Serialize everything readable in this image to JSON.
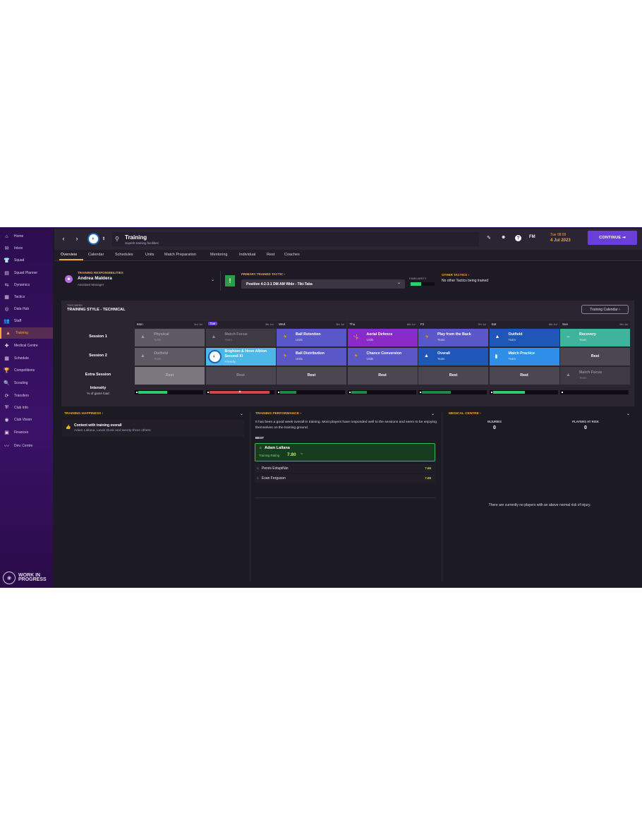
{
  "sidebar": {
    "items": [
      {
        "label": "Home",
        "icon": "⌂"
      },
      {
        "label": "Inbox",
        "icon": "✉"
      },
      {
        "label": "Squad",
        "icon": "👕"
      },
      {
        "label": "Squad Planner",
        "icon": "▤"
      },
      {
        "label": "Dynamics",
        "icon": "⇆"
      },
      {
        "label": "Tactics",
        "icon": "▦"
      },
      {
        "label": "Data Hub",
        "icon": "◎"
      },
      {
        "label": "Staff",
        "icon": "👥"
      },
      {
        "label": "Training",
        "icon": "▲"
      },
      {
        "label": "Medical Centre",
        "icon": "✚"
      },
      {
        "label": "Schedule",
        "icon": "▦"
      },
      {
        "label": "Competitions",
        "icon": "🏆"
      },
      {
        "label": "Scouting",
        "icon": "🔍"
      },
      {
        "label": "Transfers",
        "icon": "⟳"
      },
      {
        "label": "Club Info",
        "icon": "⛨"
      },
      {
        "label": "Club Vision",
        "icon": "◉"
      },
      {
        "label": "Finances",
        "icon": "▣"
      },
      {
        "label": "Dev. Centre",
        "icon": "〰"
      }
    ],
    "active_index": 8,
    "wip_label_1": "WORK IN",
    "wip_label_2": "PROGRESS"
  },
  "header": {
    "title": "Training",
    "subtitle": "Superb training facilities",
    "fm_label": "FM",
    "time": "Tue 08:00",
    "date": "4 Jul 2023",
    "continue_label": "CONTINUE"
  },
  "tabs": [
    "Overview",
    "Calendar",
    "Schedules",
    "Units",
    "Match Preparation",
    "Mentoring",
    "Individual",
    "Rest",
    "Coaches"
  ],
  "responsibilities": {
    "label": "TRAINING RESPONSIBILITIES",
    "name": "Andrea Maldera",
    "role": "Assistant Manager"
  },
  "primary_tactic": {
    "label": "PRIMARY TRAINED TACTIC",
    "value": "Positive 4-2-3-1 DM AM Wide - Tiki-Taka",
    "familiarity_label": "FAMILIARITY",
    "familiarity": 0.45
  },
  "other_tactics": {
    "label": "OTHER TACTICS",
    "value": "No other Tactics being trained"
  },
  "week": {
    "this_week": "THIS WEEK",
    "style": "TRAINING STYLE - TECHNICAL",
    "calendar_button": "Training Calendar",
    "row_labels": {
      "s1": "Session 1",
      "s2": "Session 2",
      "extra": "Extra Session",
      "intensity": "Intensity",
      "intensity_sub": "% of game load"
    },
    "days": [
      {
        "name": "Mon",
        "date": "3rd Jul",
        "today": false
      },
      {
        "name": "Tue",
        "date": "4th Jul",
        "today": true
      },
      {
        "name": "Wed",
        "date": "5th Jul",
        "today": false
      },
      {
        "name": "Thu",
        "date": "6th Jul",
        "today": false
      },
      {
        "name": "Fri",
        "date": "7th Jul",
        "today": false
      },
      {
        "name": "Sat",
        "date": "8th Jul",
        "today": false
      },
      {
        "name": "Sun",
        "date": "9th Jul",
        "today": false
      }
    ],
    "session1": [
      {
        "title": "Physical",
        "sub": "Team",
        "color": "#5d5a63",
        "dim": true,
        "icon": "▲"
      },
      {
        "title": "Match Focus",
        "sub": "Team",
        "color": "#3d3a44",
        "dim": true,
        "icon": "▲"
      },
      {
        "title": "Ball Retention",
        "sub": "Units",
        "color": "#5a57c9",
        "dim": false,
        "icon": "🏃"
      },
      {
        "title": "Aerial Defence",
        "sub": "Units",
        "color": "#8a2bc9",
        "dim": false,
        "icon": "🤸"
      },
      {
        "title": "Play from the Back",
        "sub": "Team",
        "color": "#5a57c9",
        "dim": false,
        "icon": "🏃"
      },
      {
        "title": "Outfield",
        "sub": "Team",
        "color": "#1f57b8",
        "dim": false,
        "icon": "▲"
      },
      {
        "title": "Recovery",
        "sub": "Team",
        "color": "#3fb39c",
        "dim": false,
        "icon": "⇔"
      }
    ],
    "session2": [
      {
        "title": "Outfield",
        "sub": "Team",
        "color": "#5d5a63",
        "dim": true,
        "icon": "▲"
      },
      {
        "title": "Brighton & Hove Albion Second XI",
        "sub": "Friendly",
        "color": "#4cb8e8",
        "dim": false,
        "icon": "badge"
      },
      {
        "title": "Ball Distribution",
        "sub": "Units",
        "color": "#5a57c9",
        "dim": false,
        "icon": "🏃"
      },
      {
        "title": "Chance Conversion",
        "sub": "Units",
        "color": "#5a57c9",
        "dim": false,
        "icon": "🏃"
      },
      {
        "title": "Overall",
        "sub": "Team",
        "color": "#1f57b8",
        "dim": false,
        "icon": "▲"
      },
      {
        "title": "Match Practice",
        "sub": "Team",
        "color": "#2f8fe8",
        "dim": false,
        "icon": "▮"
      },
      {
        "title": "Rest",
        "sub": "",
        "color": "#4a4751",
        "dim": false,
        "icon": ""
      }
    ],
    "extra": [
      {
        "title": "Rest",
        "sub": "",
        "color": "#7a777f",
        "dim": true,
        "icon": ""
      },
      {
        "title": "Rest",
        "sub": "",
        "color": "#4a4751",
        "dim": true,
        "icon": ""
      },
      {
        "title": "Rest",
        "sub": "",
        "color": "#4a4751",
        "dim": false,
        "icon": ""
      },
      {
        "title": "Rest",
        "sub": "",
        "color": "#4a4751",
        "dim": false,
        "icon": ""
      },
      {
        "title": "Rest",
        "sub": "",
        "color": "#4a4751",
        "dim": false,
        "icon": ""
      },
      {
        "title": "Rest",
        "sub": "",
        "color": "#4a4751",
        "dim": false,
        "icon": ""
      },
      {
        "title": "Match Focus",
        "sub": "Team",
        "color": "#3d3a44",
        "dim": true,
        "icon": "▲"
      }
    ],
    "intensity": [
      {
        "fill": 0.45,
        "color": "#2ecc71"
      },
      {
        "fill": 0.95,
        "color": "#d64545"
      },
      {
        "fill": 0.25,
        "color": "#1f8a49"
      },
      {
        "fill": 0.25,
        "color": "#1f8a49"
      },
      {
        "fill": 0.45,
        "color": "#1f8a49"
      },
      {
        "fill": 0.5,
        "color": "#2ecc71"
      },
      {
        "fill": 0.0,
        "color": "#2ecc71"
      }
    ]
  },
  "happiness": {
    "label": "TRAINING HAPPINESS",
    "title": "Content with training overall",
    "detail": "Adam Lallana, Lewis Dunk and twenty-three others"
  },
  "performance": {
    "label": "TRAINING PERFORMANCE",
    "summary": "It has been a good week overall in training. Most players have responded well to the sessions and seem to be enjoying themselves on the training ground.",
    "best_label": "BEST",
    "best_name": "Adam Lallana",
    "best_rating_label": "Training Rating",
    "best_rating": "7.80",
    "others": [
      {
        "name": "Pervis Estupiñán",
        "rating": "7.65"
      },
      {
        "name": "Evan Ferguson",
        "rating": "7.65"
      }
    ]
  },
  "medical": {
    "label": "MEDICAL CENTRE",
    "injuries_label": "INJURIES",
    "injuries": "0",
    "risk_label": "PLAYERS AT RISK",
    "risk": "0",
    "note": "There are currently no players with an above normal risk of injury."
  }
}
